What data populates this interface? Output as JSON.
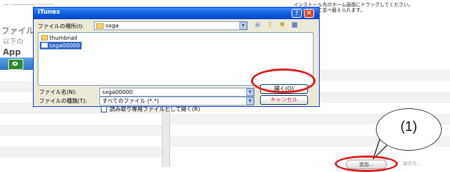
{
  "background": {
    "top_text": "— ―――――――",
    "hint_lines": [
      "インストール先のホーム画面にドラッグしてください。",
      "ドラッグして並べ替えられます。"
    ],
    "section_title": "ファイル",
    "section_sub": "以下の",
    "app_label": "App",
    "add_button": "追加...",
    "save_button": "保存先..."
  },
  "annotation": {
    "callout_label": "(1)",
    "accent_color": "#e01818"
  },
  "dialog": {
    "title": "iTunes",
    "help_icon": "?",
    "close_icon": "✕",
    "look_in_label": "ファイルの場所(I):",
    "look_in_value": "sxga",
    "files": [
      {
        "name": "thumbnail",
        "icon": "folder-icon",
        "selected": false
      },
      {
        "name": "sxga00000",
        "icon": "file-icon",
        "selected": true
      }
    ],
    "filename_label": "ファイル名(N):",
    "filename_value": "sxga00000",
    "filetype_label": "ファイルの種類(T):",
    "filetype_value": "すべてのファイル (*.*)",
    "readonly_label": "読み取り専用ファイルとして開く(R)",
    "open_button": "開く(O)",
    "cancel_button": "キャンセル"
  }
}
